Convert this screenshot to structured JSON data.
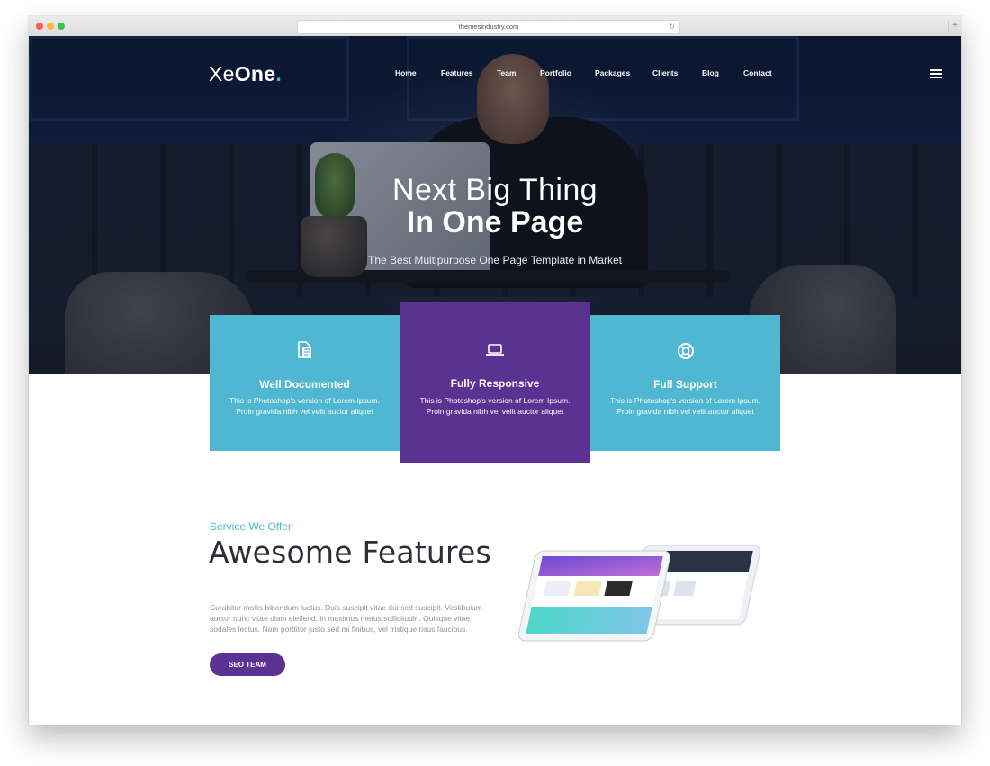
{
  "browser": {
    "url": "themesindustry.com"
  },
  "logo": {
    "part1": "Xe",
    "part2": "One",
    "dot": "."
  },
  "nav": {
    "items": [
      "Home",
      "Features",
      "Team",
      "Portfolio",
      "Packages",
      "Clients",
      "Blog",
      "Contact"
    ]
  },
  "hero": {
    "title_line1": "Next Big Thing",
    "title_line2": "In One Page",
    "subtitle": "The Best Multipurpose One Page Template in Market"
  },
  "cards": [
    {
      "icon": "document-icon",
      "title": "Well Documented",
      "text": "This is Photoshop's version of Lorem Ipsum. Proin gravida nibh vel velit auctor aliquet",
      "color": "#4fb7d1"
    },
    {
      "icon": "laptop-icon",
      "title": "Fully Responsive",
      "text": "This is Photoshop's version of Lorem Ipsum. Proin gravida nibh vel velit auctor aliquet",
      "color": "#5b3192"
    },
    {
      "icon": "lifebuoy-icon",
      "title": "Full Support",
      "text": "This is Photoshop's version of Lorem Ipsum. Proin gravida nibh vel velit auctor aliquet",
      "color": "#4fb7d1"
    }
  ],
  "services": {
    "subtitle": "Service We Offer",
    "title": "Awesome Features",
    "text": "Curabitur mollis bibendum luctus. Duis suscipit vitae dui sed suscipit. Vestibulum auctor nunc vitae diam eleifend, in maximus metus sollicitudin. Quisque vitae sodales lectus. Nam porttitor justo sed mi finibus, vel tristique risus faucibus.",
    "button": "SEO TEAM"
  },
  "colors": {
    "accent_blue": "#4fb7d1",
    "accent_purple": "#5b3192",
    "heading": "#2d2d33"
  }
}
